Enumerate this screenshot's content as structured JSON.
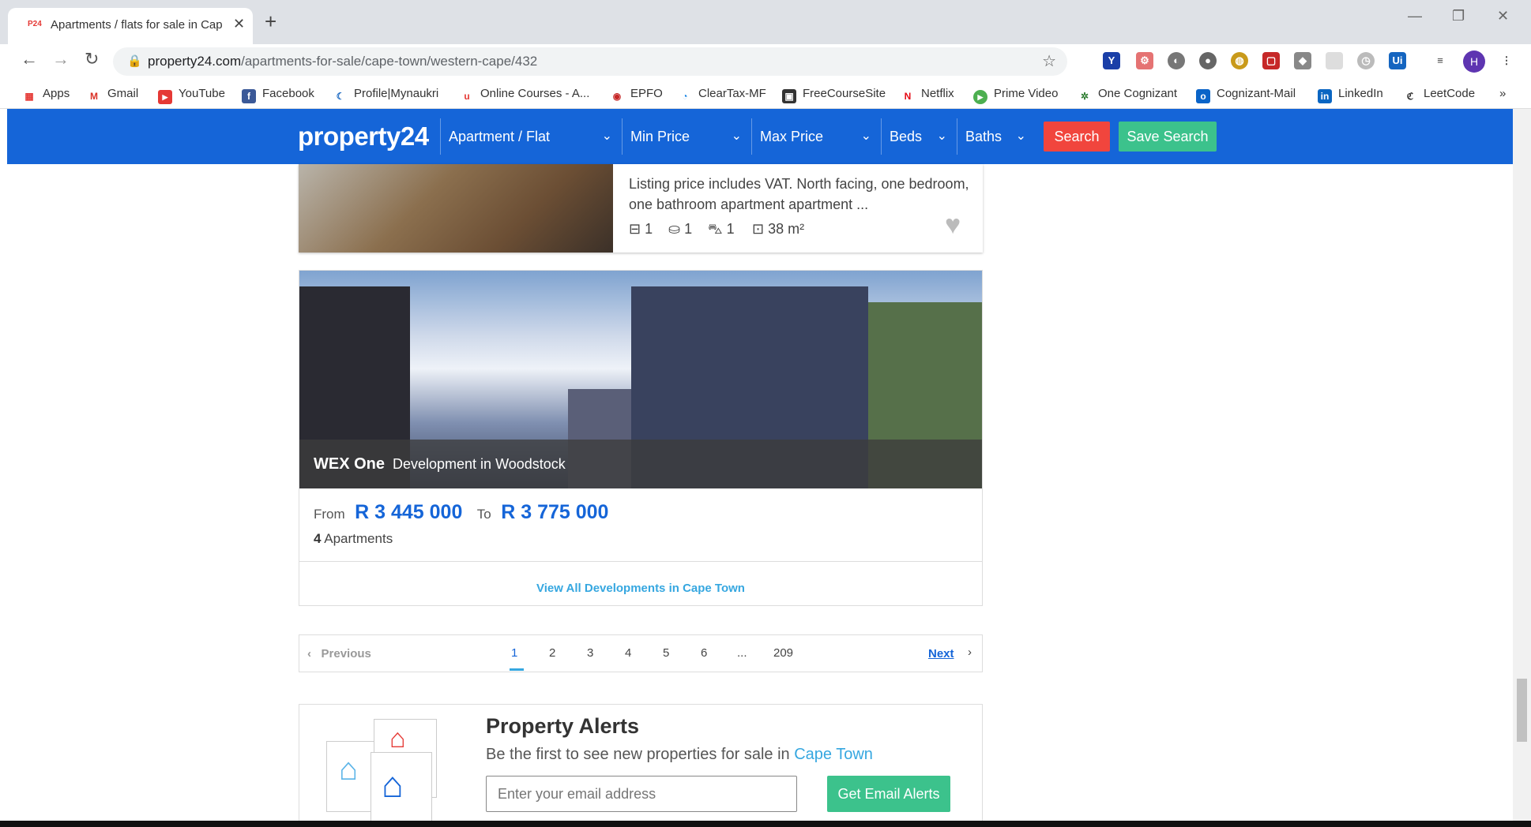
{
  "tab": {
    "favicon": "P24",
    "title": "Apartments / flats for sale in Cap",
    "close": "✕"
  },
  "newtab": "+",
  "window": {
    "minimize": "—",
    "restore": "❐",
    "close": "✕"
  },
  "nav": {
    "back": "←",
    "forward": "→",
    "reload": "↻"
  },
  "url": {
    "host": "property24.com",
    "path": "/apartments-for-sale/cape-town/western-cape/432"
  },
  "bookmarks": [
    "Apps",
    "Gmail",
    "YouTube",
    "Facebook",
    "Profile|Mynaukri",
    "Online Courses - A...",
    "EPFO",
    "ClearTax-MF",
    "FreeCourseSite",
    "Netflix",
    "Prime Video",
    "One Cognizant",
    "Cognizant-Mail",
    "LinkedIn",
    "LeetCode"
  ],
  "bookmark_more": "»",
  "avatar": "H",
  "site": {
    "logo": "property24",
    "filters": [
      "Apartment / Flat",
      "Min Price",
      "Max Price",
      "Beds",
      "Baths"
    ],
    "search": "Search",
    "save_search": "Save Search"
  },
  "listing": {
    "description": "Listing price includes VAT. North facing, one bedroom, one bathroom apartment apartment ...",
    "beds": "1",
    "baths": "1",
    "parking": "1",
    "size": "38 m²"
  },
  "development": {
    "name": "WEX One",
    "subtitle": "Development in Woodstock",
    "from_label": "From",
    "from_price": "R 3 445 000",
    "to_label": "To",
    "to_price": "R 3 775 000",
    "count": "4",
    "count_label": "Apartments",
    "view_all": "View All Developments in Cape Town"
  },
  "pagination": {
    "previous": "Previous",
    "pages": [
      "1",
      "2",
      "3",
      "4",
      "5",
      "6",
      "...",
      "209"
    ],
    "next": "Next"
  },
  "alerts": {
    "title": "Property Alerts",
    "subtitle": "Be the first to see new properties for sale in",
    "city": "Cape Town",
    "placeholder": "Enter your email address",
    "button": "Get Email Alerts"
  }
}
